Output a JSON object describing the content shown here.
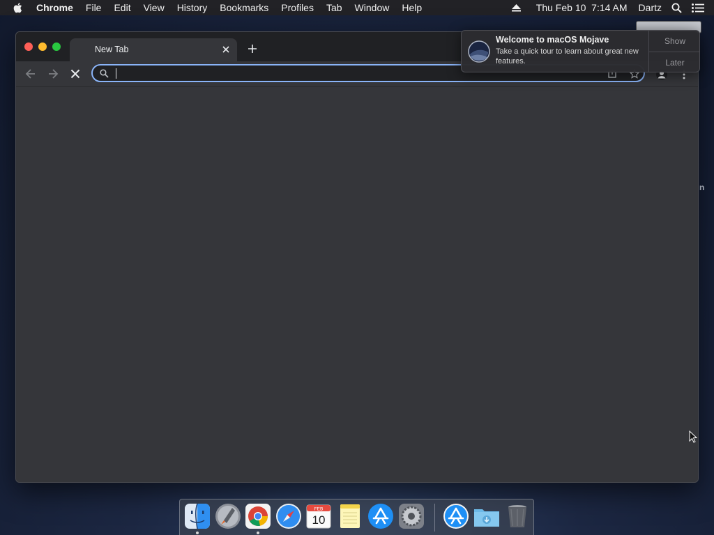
{
  "menubar": {
    "app_name": "Chrome",
    "items": [
      "File",
      "Edit",
      "View",
      "History",
      "Bookmarks",
      "Profiles",
      "Tab",
      "Window",
      "Help"
    ],
    "datetime": "Thu Feb 10  7:14 AM",
    "user": "Dartz"
  },
  "browser": {
    "tab_title": "New Tab",
    "omnibox_value": "",
    "accent_color": "#8ab4f8"
  },
  "notification": {
    "title": "Welcome to macOS Mojave",
    "body": "Take a quick tour to learn about great new features.",
    "show_label": "Show",
    "later_label": "Later"
  },
  "background": {
    "peek_text": "n"
  },
  "dock": {
    "calendar_month": "FEB",
    "calendar_day": "10",
    "items": [
      "finder-icon",
      "launchpad-icon",
      "chrome-icon",
      "safari-icon",
      "calendar-icon",
      "notes-icon",
      "app-store-icon",
      "system-preferences-icon",
      "app-store-icon",
      "downloads-folder-icon",
      "trash-icon"
    ]
  }
}
